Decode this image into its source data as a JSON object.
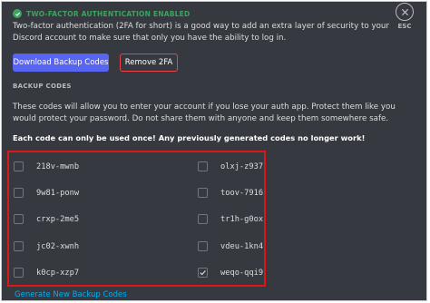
{
  "header": {
    "title": "TWO-FACTOR AUTHENTICATION ENABLED"
  },
  "esc": {
    "label": "ESC"
  },
  "description": "Two-factor authentication (2FA for short) is a good way to add an extra layer of security to your Discord account to make sure that only you have the ability to log in.",
  "buttons": {
    "download": "Download Backup Codes",
    "remove": "Remove 2FA"
  },
  "backup": {
    "label": "BACKUP CODES",
    "info": "These codes will allow you to enter your account if you lose your auth app. Protect them like you would protect your password. Do not share them with anyone and keep them somewhere safe.",
    "warning": "Each code can only be used once! Any previously generated codes no longer work!",
    "codes": [
      {
        "code": "218v-mwnb",
        "used": false
      },
      {
        "code": "olxj-z937",
        "used": false
      },
      {
        "code": "9w81-ponw",
        "used": false
      },
      {
        "code": "toov-7916",
        "used": false
      },
      {
        "code": "crxp-2me5",
        "used": false
      },
      {
        "code": "tr1h-g0ox",
        "used": false
      },
      {
        "code": "jc02-xwnh",
        "used": false
      },
      {
        "code": "vdeu-1kn4",
        "used": false
      },
      {
        "code": "k0cp-xzp7",
        "used": false
      },
      {
        "code": "weqo-qqi9",
        "used": true
      }
    ],
    "generate_link": "Generate New Backup Codes"
  },
  "colors": {
    "accent": "#5865f2",
    "success": "#3ba55d",
    "danger": "#ed4245",
    "highlight": "#e01515",
    "link": "#00aff4"
  },
  "icons": {
    "header": "check-circle-icon",
    "close": "close-icon",
    "used_code": "checkmark-icon"
  }
}
